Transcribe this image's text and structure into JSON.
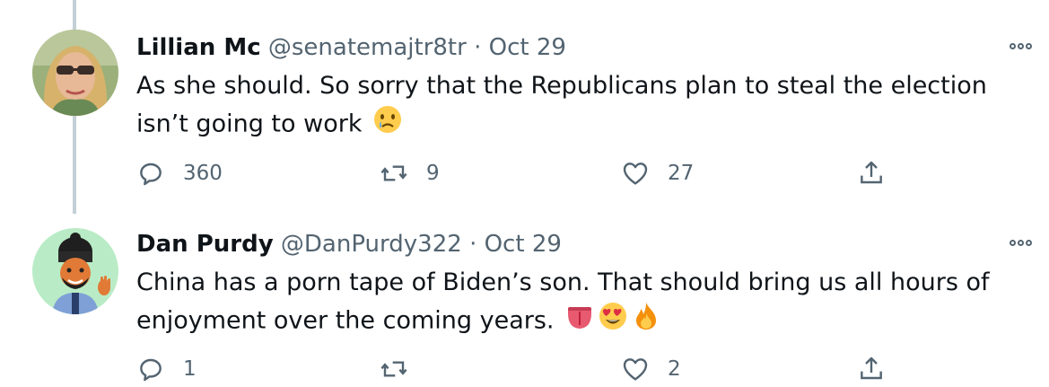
{
  "tweets": [
    {
      "name": "Lillian Mc",
      "handle": "@senatemajtr8tr",
      "separator": "·",
      "date": "Oct 29",
      "text": "As she should. So sorry that the Republicans plan to steal the election isn’t going to work",
      "emoji": [
        "crying-face"
      ],
      "replies": "360",
      "retweets": "9",
      "likes": "27"
    },
    {
      "name": "Dan Purdy",
      "handle": "@DanPurdy322",
      "separator": "·",
      "date": "Oct 29",
      "text": "China has a porn tape of Biden’s son. That should bring us all hours of enjoyment over the coming years.",
      "emoji": [
        "tongue",
        "heart-eyes-face",
        "fire"
      ],
      "replies": "1",
      "retweets": "",
      "likes": "2"
    }
  ],
  "icons": {
    "reply": "reply-icon",
    "retweet": "retweet-icon",
    "like": "like-icon",
    "share": "share-icon",
    "more": "more-icon"
  },
  "colors": {
    "text": "#0f1419",
    "secondary": "#536471",
    "thread_line": "#c4cfd6"
  }
}
